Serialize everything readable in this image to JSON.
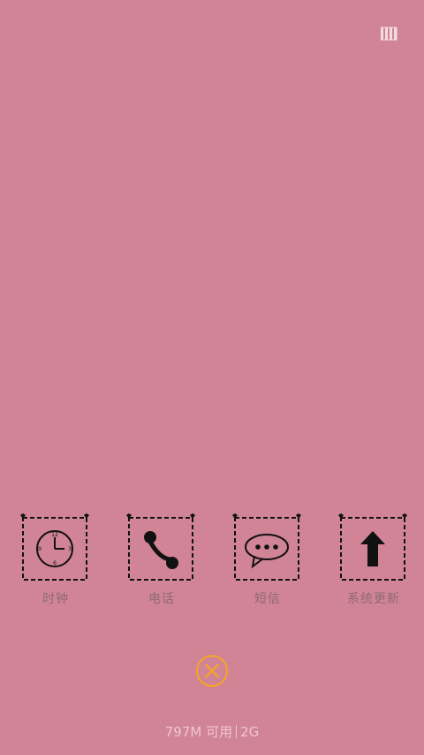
{
  "status": {
    "icon": "recent-apps-icon"
  },
  "apps": [
    {
      "label": "时钟",
      "icon": "clock-icon"
    },
    {
      "label": "电话",
      "icon": "phone-icon"
    },
    {
      "label": "短信",
      "icon": "message-icon"
    },
    {
      "label": "系统更新",
      "icon": "update-arrow-icon"
    }
  ],
  "close_button": {
    "icon": "close-icon",
    "color": "#f5a623"
  },
  "memory": {
    "available": "797M 可用",
    "total": "2G"
  },
  "colors": {
    "background": "#d18496",
    "label": "#8e6a71",
    "memory_text": "#f0c7cf"
  }
}
